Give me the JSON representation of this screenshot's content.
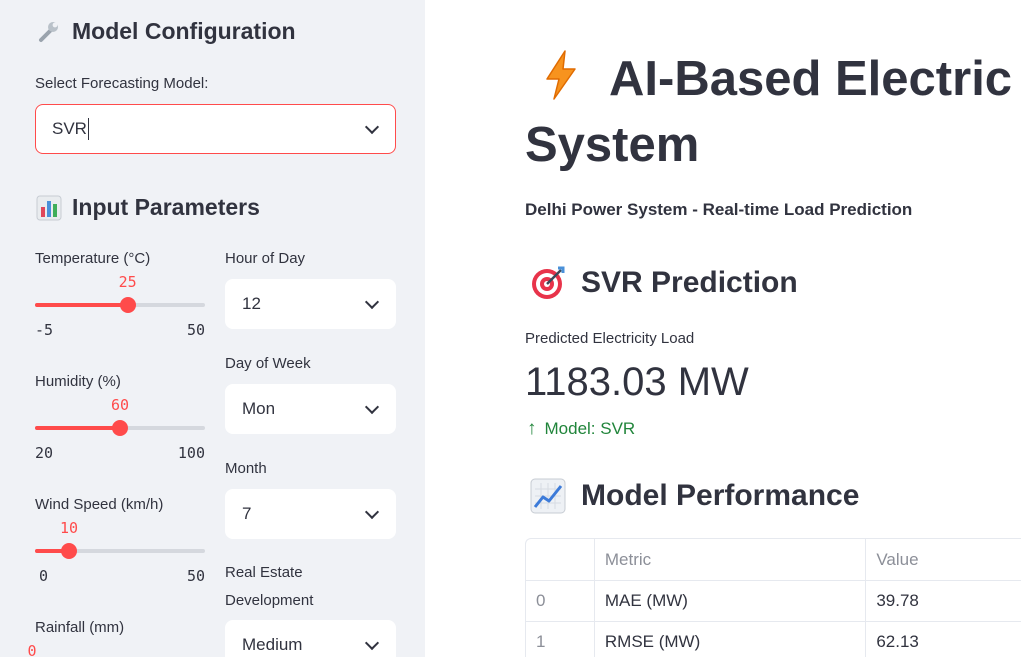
{
  "sidebar": {
    "config_heading": "Model Configuration",
    "model_select_label": "Select Forecasting Model:",
    "model_select_value": "SVR",
    "input_heading": "Input Parameters",
    "sliders": [
      {
        "label": "Temperature (°C)",
        "value": "25",
        "min": "-5",
        "max": "50",
        "fraction": 0.545
      },
      {
        "label": "Humidity (%)",
        "value": "60",
        "min": "20",
        "max": "100",
        "fraction": 0.5
      },
      {
        "label": "Wind Speed (km/h)",
        "value": "10",
        "min": "0",
        "max": "50",
        "fraction": 0.2
      },
      {
        "label": "Rainfall (mm)",
        "value": "0",
        "min": "",
        "max": "",
        "fraction": 0
      }
    ],
    "selects": [
      {
        "label": "Hour of Day",
        "value": "12"
      },
      {
        "label": "Day of Week",
        "value": "Mon"
      },
      {
        "label": "Month",
        "value": "7"
      },
      {
        "label": "Real Estate Development",
        "value": "Medium"
      }
    ],
    "icons": {
      "config": "wrench-icon",
      "input": "bar-chart-icon"
    }
  },
  "main": {
    "title": "AI-Based Electric System",
    "title_line1": "AI-Based Electric",
    "title_line2": "System",
    "subtitle": "Delhi Power System - Real-time Load Prediction",
    "prediction_heading": "SVR Prediction",
    "metric_label": "Predicted Electricity Load",
    "metric_value": "1183.03 MW",
    "metric_delta": "Model: SVR",
    "performance_heading": "Model Performance",
    "table": {
      "columns": [
        "",
        "Metric",
        "Value"
      ],
      "rows": [
        [
          "0",
          "MAE (MW)",
          "39.78"
        ],
        [
          "1",
          "RMSE (MW)",
          "62.13"
        ]
      ]
    },
    "icons": {
      "title": "lightning-icon",
      "prediction": "target-icon",
      "performance": "chart-increasing-icon"
    }
  },
  "colors": {
    "accent": "#ff4b4b",
    "sidebar_bg": "#f0f2f6",
    "delta_green": "#21853b",
    "text": "#31333f"
  }
}
